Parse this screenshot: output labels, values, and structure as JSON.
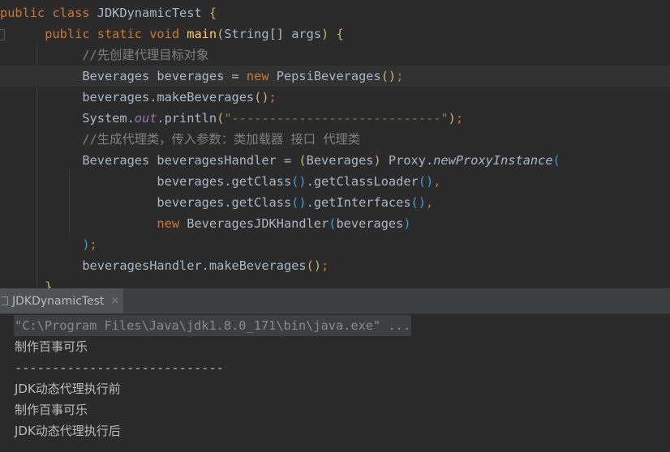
{
  "editor": {
    "lines": [
      "public class JDKDynamicTest {",
      "    public static void main(String[] args) {",
      "        //先创建代理目标对象",
      "        Beverages beverages = new PepsiBeverages();",
      "        beverages.makeBeverages();",
      "        System.out.println(\"----------------------------\");",
      "        //生成代理类，传入参数：类加载器 接口 代理类",
      "        Beverages beveragesHandler = (Beverages) Proxy.newProxyInstance(",
      "                beverages.getClass().getClassLoader(),",
      "                beverages.getClass().getInterfaces(),",
      "                new BeveragesJDKHandler(beverages)",
      "        );",
      "        beveragesHandler.makeBeverages();",
      "    }"
    ],
    "current_line": 4
  },
  "console": {
    "tab_label": "JDKDynamicTest",
    "tab_close": "×",
    "command": "\"C:\\Program Files\\Java\\jdk1.8.0_171\\bin\\java.exe\" ...",
    "output": [
      "制作百事可乐",
      "----------------------------",
      "JDK动态代理执行前",
      "制作百事可乐",
      "JDK动态代理执行后"
    ]
  },
  "colors": {
    "background": "#2b2b2b",
    "keyword": "#cc7832",
    "method": "#ffc66d",
    "comment": "#808080",
    "string": "#6a8759",
    "field": "#9876aa",
    "text": "#a9b7c6"
  }
}
